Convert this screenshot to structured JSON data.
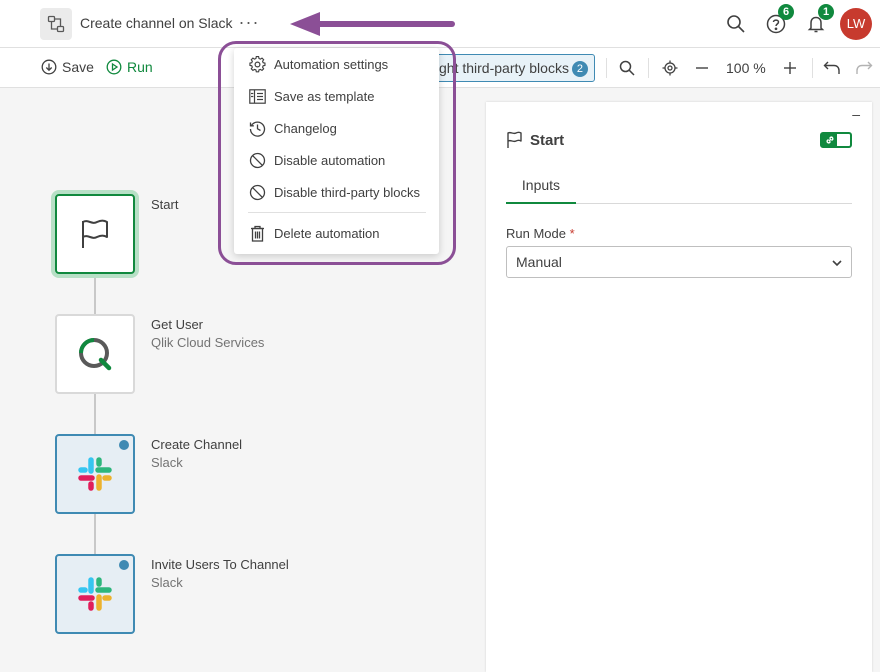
{
  "header": {
    "title": "Create channel on Slack",
    "more_label": "···",
    "help_badge": "6",
    "notifications_badge": "1",
    "avatar_initials": "LW"
  },
  "toolbar": {
    "save_label": "Save",
    "run_label": "Run",
    "highlight_label": "ght third-party blocks",
    "highlight_count": "2",
    "zoom": "100 %"
  },
  "menu": {
    "items": [
      {
        "label": "Automation settings",
        "icon": "gear-icon"
      },
      {
        "label": "Save as template",
        "icon": "template-icon"
      },
      {
        "label": "Changelog",
        "icon": "history-icon"
      },
      {
        "label": "Disable automation",
        "icon": "disable-icon"
      },
      {
        "label": "Disable third-party blocks",
        "icon": "disable-icon"
      },
      {
        "label": "Delete automation",
        "icon": "trash-icon"
      }
    ]
  },
  "blocks": [
    {
      "label": "Start",
      "sub": ""
    },
    {
      "label": "Get User",
      "sub": "Qlik Cloud Services"
    },
    {
      "label": "Create Channel",
      "sub": "Slack"
    },
    {
      "label": "Invite Users To Channel",
      "sub": "Slack"
    }
  ],
  "panel": {
    "minimize": "–",
    "title": "Start",
    "tab": "Inputs",
    "field_label": "Run Mode",
    "required_mark": "*",
    "field_value": "Manual"
  },
  "colors": {
    "accent_green": "#10893e",
    "accent_blue": "#3f8ab3",
    "annotation_purple": "#8b4f96",
    "avatar_red": "#c73a2e"
  }
}
